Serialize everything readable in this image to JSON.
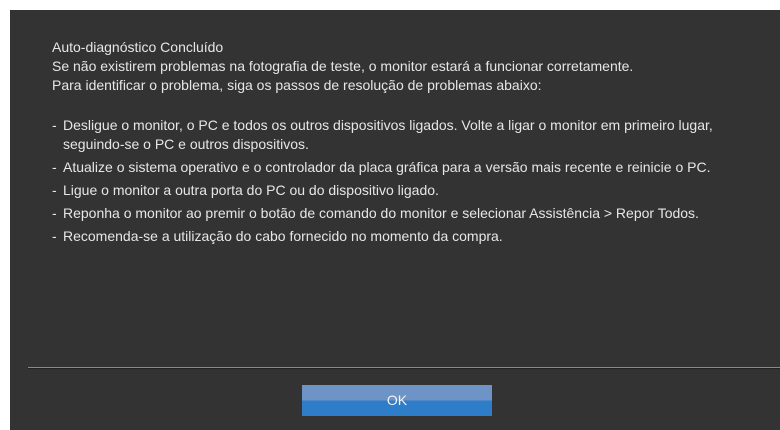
{
  "dialog": {
    "title": "Auto-diagnóstico Concluído",
    "line1": "Se não existirem problemas na fotografia de teste, o monitor estará a funcionar corretamente.",
    "line2": "Para identificar o problema, siga os passos de resolução de problemas abaixo:",
    "steps": [
      "Desligue o monitor, o PC e todos os outros dispositivos ligados. Volte a ligar o monitor em primeiro lugar, seguindo-se o PC e outros dispositivos.",
      "Atualize o sistema operativo e o controlador da placa gráfica para a versão mais recente e reinicie o PC.",
      "Ligue o monitor a outra porta do PC ou do dispositivo ligado.",
      "Reponha o monitor ao premir o botão de comando do monitor e selecionar Assistência > Repor Todos.",
      "Recomenda-se a utilização do cabo fornecido no momento da compra."
    ],
    "ok_label": "OK"
  },
  "colors": {
    "background": "#333333",
    "text": "#e6e6e6",
    "button_top": "#6e93c7",
    "button_bottom": "#2e7dc8"
  }
}
